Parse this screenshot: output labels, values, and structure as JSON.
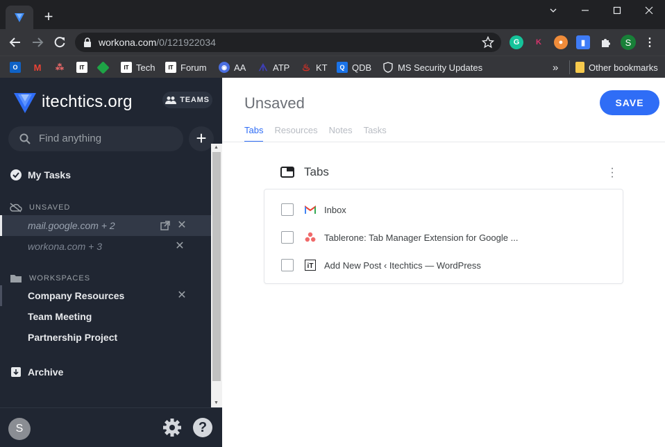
{
  "browser": {
    "url_host": "workona.com",
    "url_path": "/0/121922034",
    "bookmarks": [
      {
        "label": "",
        "icon": "outlook-icon",
        "color": "#0f62c6"
      },
      {
        "label": "",
        "icon": "gmail-icon",
        "color": "#ea4335"
      },
      {
        "label": "",
        "icon": "asana-icon",
        "color": "#f06a6a"
      },
      {
        "label": "",
        "icon": "itechtics-icon",
        "color": "#ffffff"
      },
      {
        "label": "",
        "icon": "diamond-icon",
        "color": "#1ea446"
      },
      {
        "label": "Tech",
        "icon": "itechtics-icon",
        "color": "#ffffff"
      },
      {
        "label": "Forum",
        "icon": "itechtics-icon",
        "color": "#ffffff"
      },
      {
        "label": "AA",
        "icon": "eye-icon",
        "color": "#4a6ee0"
      },
      {
        "label": "ATP",
        "icon": "atp-icon",
        "color": "#3e3fb5"
      },
      {
        "label": "KT",
        "icon": "flame-icon",
        "color": "#d93025"
      },
      {
        "label": "QDB",
        "icon": "q-icon",
        "color": "#1a73e8"
      },
      {
        "label": "MS Security Updates",
        "icon": "shield-icon",
        "color": "#e8eaed"
      }
    ],
    "overflow": "»",
    "other_bookmarks": "Other bookmarks",
    "profile_initial": "S"
  },
  "sidebar": {
    "brand": "itechtics.org",
    "teams_label": "TEAMS",
    "search_placeholder": "Find anything",
    "my_tasks": "My Tasks",
    "unsaved_header": "UNSAVED",
    "unsaved_items": [
      "mail.google.com + 2",
      "workona.com + 3"
    ],
    "workspaces_header": "WORKSPACES",
    "workspaces": [
      "Company Resources",
      "Team Meeting",
      "Partnership Project"
    ],
    "archive": "Archive",
    "avatar_initial": "S"
  },
  "main": {
    "title": "Unsaved",
    "save_label": "SAVE",
    "tabs": [
      "Tabs",
      "Resources",
      "Notes",
      "Tasks"
    ],
    "section_title": "Tabs",
    "tab_rows": [
      {
        "title": "Inbox",
        "icon": "gmail-icon"
      },
      {
        "title": "Tablerone: Tab Manager Extension for Google ...",
        "icon": "asana-icon"
      },
      {
        "title": "Add New Post ‹ Itechtics — WordPress",
        "icon": "itechtics-icon"
      }
    ]
  },
  "colors": {
    "accent": "#2f6df6",
    "sidebar_bg": "#202632",
    "chrome_bg": "#202124"
  }
}
